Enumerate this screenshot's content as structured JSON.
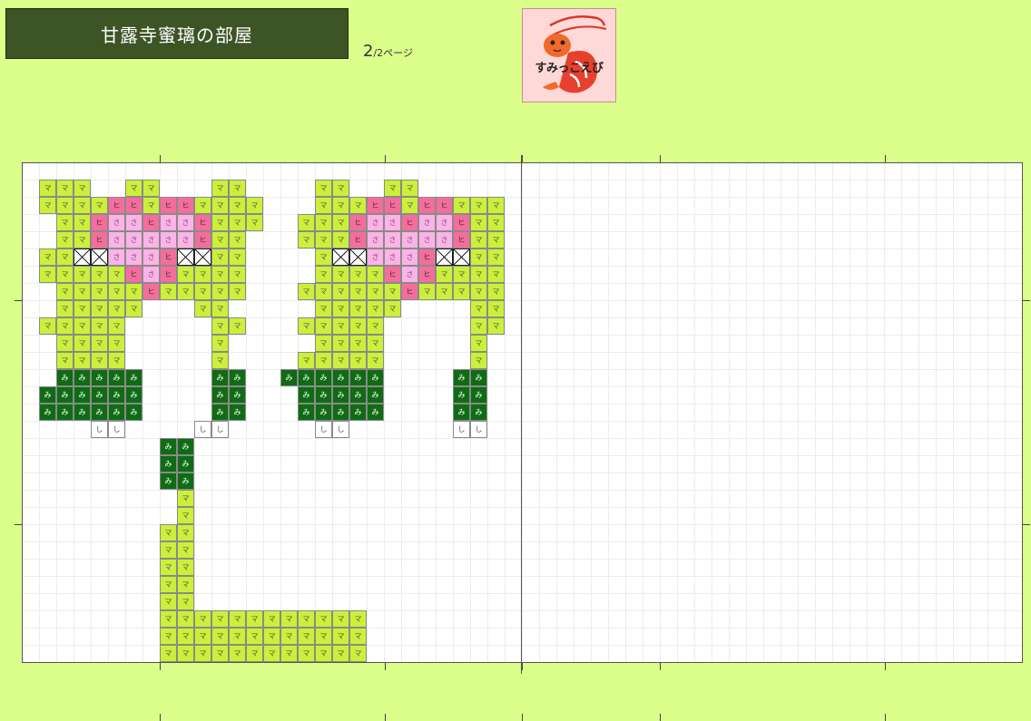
{
  "header": {
    "title": "甘露寺蜜璃の部屋",
    "page_current": "2",
    "page_rest": "/2ページ"
  },
  "logo": {
    "text": "すみっこえび",
    "icon": "shrimp-icon"
  },
  "colors": {
    "background": "#dcff8c",
    "title_bg": "#3d5426",
    "light_green": "#ccf03a",
    "dark_green": "#0f6b14",
    "pink": "#f56d9c",
    "light_pink": "#fcb3e6",
    "white": "#ffffff"
  },
  "legend_symbols": {
    "light_green": "マ",
    "dark_green": "み",
    "pink": "ヒ",
    "light_pink": "さ",
    "white": "し",
    "cross": "x"
  },
  "pattern": {
    "legend": {
      "L": "light_green",
      "D": "dark_green",
      "P": "pink",
      "K": "light_pink",
      "W": "white",
      "X": "cross",
      ".": "empty"
    },
    "rows": [
      ".LLL..LL...LL....LL..LL.....",
      ".LLLLPPLPPLLLL...LLLPPLPPLLL",
      "..LLPKKPKKPLLL..LLLPKKPKKPLL",
      "..LLPKKKKKPLL...LLLPKKKKKPLL",
      ".LLXXKKKPXXLL....LXXKKKPXXLL",
      ".LLLLLPKPLLLL....LLLLPKPLLLL",
      "..LLLLLPLLLLL...LLLLLLPLLLLL",
      "..LLLLL...LL.....LLLLL....LL",
      ".LLLLL.....LL...LLLLL.....LL",
      "..LLLL.....L.....LLLL.....L.",
      "..LLLL.....L....LLLLL.....L.",
      "..DDDDD....DD..DDDDDD....DD.",
      ".DDDDDD....DD...DDDDD....DD.",
      ".DDDDDD....DD...DDDDD....DD.",
      "....WW....WW.....WW......WW.",
      "........DD..................",
      "........DD..................",
      "........DD..................",
      ".........L..................",
      ".........L..................",
      "........LL..................",
      "........LL..................",
      "........LL..................",
      "........LL..................",
      "........LL..................",
      "........LLLLLLLLLLLL........",
      "........LLLLLLLLLLLL........",
      "........LLLLLLLLLLLL........"
    ]
  }
}
